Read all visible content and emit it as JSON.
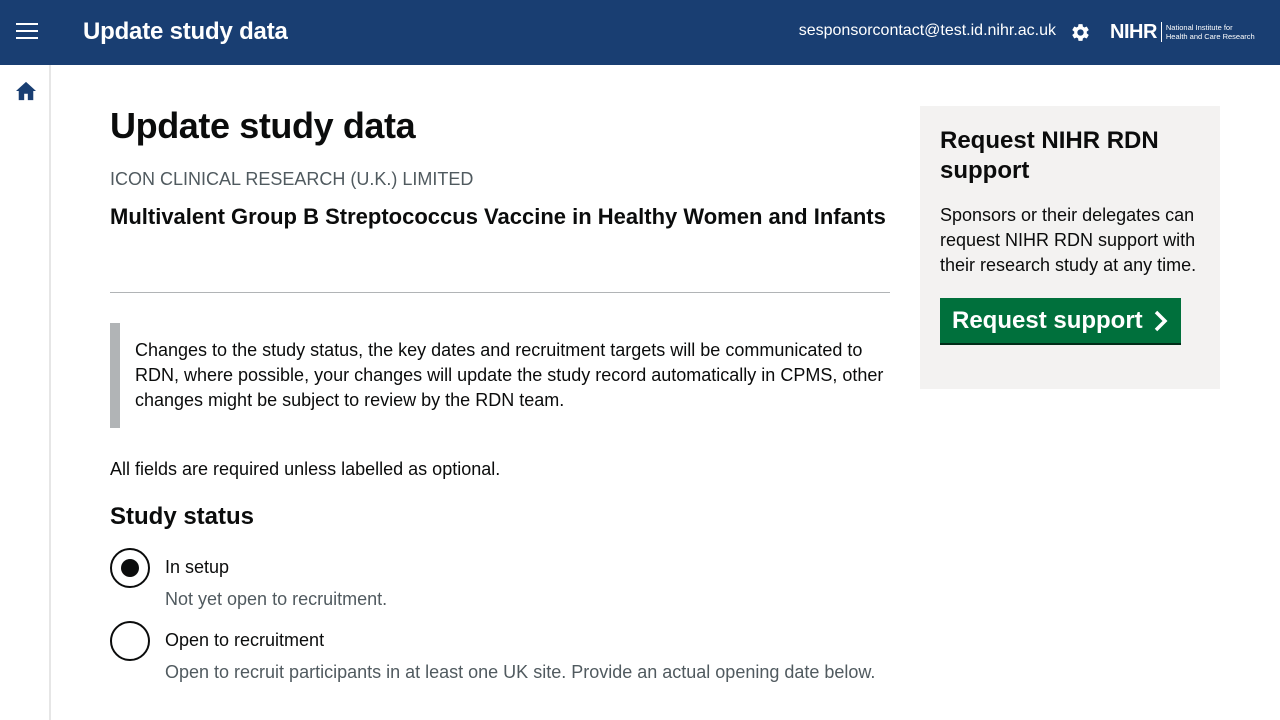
{
  "header": {
    "title": "Update study data",
    "user_email": "sesponsorcontact@test.id.nihr.ac.uk",
    "logo_mark": "NIHR",
    "logo_text_line1": "National Institute for",
    "logo_text_line2": "Health and Care Research",
    "menu_icon": "hamburger-menu-icon",
    "settings_icon": "gear-icon",
    "background_color": "#193e72"
  },
  "sidenav": {
    "home_icon": "home-icon"
  },
  "main": {
    "page_title": "Update study data",
    "organisation": "ICON CLINICAL RESEARCH (U.K.) LIMITED",
    "study_title": "Multivalent Group B Streptococcus Vaccine in Healthy Women and Infants",
    "inset_text": "Changes to the study status, the key dates and recruitment targets will be communicated to RDN, where possible, your changes will update the study record automatically in CPMS, other changes might be subject to review by the RDN team.",
    "required_note": "All fields are required unless labelled as optional.",
    "study_status_heading": "Study status",
    "status_options": [
      {
        "label": "In setup",
        "hint": "Not yet open to recruitment.",
        "checked": true
      },
      {
        "label": "Open to recruitment",
        "hint": "Open to recruit participants in at least one UK site. Provide an actual opening date below.",
        "checked": false
      }
    ]
  },
  "aside": {
    "title": "Request NIHR RDN support",
    "text": "Sponsors or their delegates can request NIHR RDN support with their research study at any time.",
    "button_label": "Request support",
    "button_color": "#00703c"
  }
}
